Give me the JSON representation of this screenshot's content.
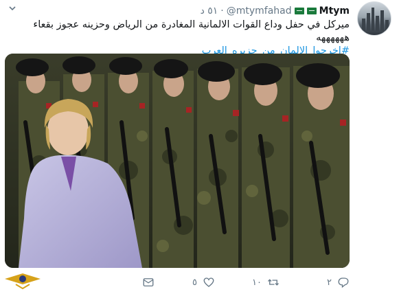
{
  "tweet": {
    "display_name": "Mtym",
    "handle": "@mtymfahad",
    "time": "٥١ د",
    "text_line1": "ميركل في حفل وداع القوات الالمانية المغادرة من الرياض  وحزينه عجوز بقعاء ههههههه",
    "hashtag": "#اخرجوا_الالمان_من_جزيره_العرب"
  },
  "actions": {
    "replies": "٢",
    "retweets": "١٠",
    "likes": "٥"
  },
  "icons": {
    "flag": "saudi-flag-emoji",
    "avatar": "city-skyline",
    "caret": "chevron-down-icon",
    "reply": "reply-icon",
    "retweet": "retweet-icon",
    "like": "heart-icon",
    "dm": "envelope-icon"
  },
  "colors": {
    "link": "#1b95e0",
    "muted": "#657786",
    "text": "#14171a",
    "flag": "#1a7a3c"
  }
}
